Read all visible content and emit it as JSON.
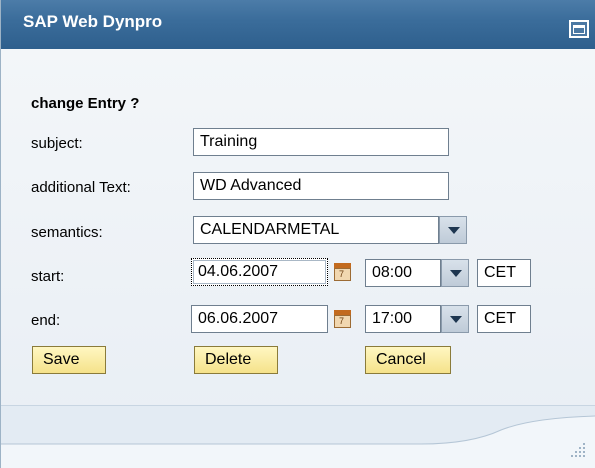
{
  "window": {
    "title": "SAP Web Dynpro",
    "maximize_icon": "window-maximize-icon"
  },
  "form": {
    "heading": "change Entry ?",
    "subject": {
      "label": "subject:",
      "value": "Training"
    },
    "additional_text": {
      "label": "additional Text:",
      "value": "WD Advanced"
    },
    "semantics": {
      "label": "semantics:",
      "value": "CALENDARMETAL"
    },
    "start": {
      "label": "start:",
      "date": "04.06.2007",
      "time": "08:00",
      "timezone": "CET"
    },
    "end": {
      "label": "end:",
      "date": "06.06.2007",
      "time": "17:00",
      "timezone": "CET"
    },
    "calendar_icon_text": "7"
  },
  "buttons": {
    "save": "Save",
    "delete": "Delete",
    "cancel": "Cancel"
  },
  "colors": {
    "titlebar": "#3b6d9b",
    "button_bg": "#f5e28a",
    "background": "#e9f0f6"
  }
}
